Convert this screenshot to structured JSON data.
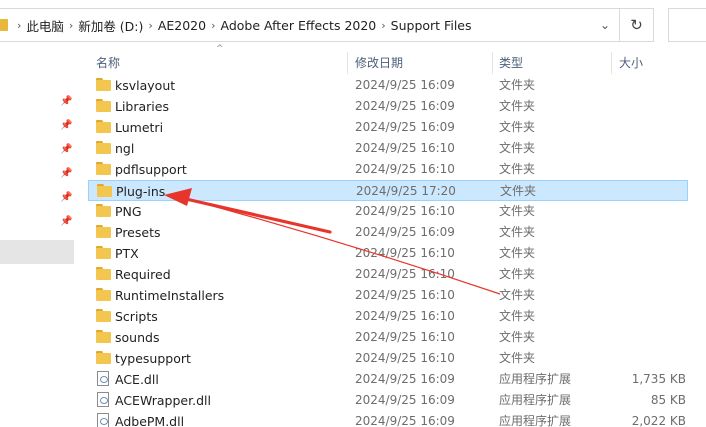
{
  "address_bar": {
    "breadcrumbs": [
      "此电脑",
      "新加卷 (D:)",
      "AE2020",
      "Adobe After Effects 2020",
      "Support Files"
    ]
  },
  "columns": {
    "name": "名称",
    "date": "修改日期",
    "type": "类型",
    "size": "大小"
  },
  "files": [
    {
      "name": "ksvlayout",
      "date": "2024/9/25 16:09",
      "type": "文件夹",
      "size": "",
      "kind": "folder"
    },
    {
      "name": "Libraries",
      "date": "2024/9/25 16:09",
      "type": "文件夹",
      "size": "",
      "kind": "folder"
    },
    {
      "name": "Lumetri",
      "date": "2024/9/25 16:09",
      "type": "文件夹",
      "size": "",
      "kind": "folder"
    },
    {
      "name": "ngl",
      "date": "2024/9/25 16:10",
      "type": "文件夹",
      "size": "",
      "kind": "folder"
    },
    {
      "name": "pdflsupport",
      "date": "2024/9/25 16:10",
      "type": "文件夹",
      "size": "",
      "kind": "folder"
    },
    {
      "name": "Plug-ins",
      "date": "2024/9/25 17:20",
      "type": "文件夹",
      "size": "",
      "kind": "folder",
      "selected": true
    },
    {
      "name": "PNG",
      "date": "2024/9/25 16:10",
      "type": "文件夹",
      "size": "",
      "kind": "folder"
    },
    {
      "name": "Presets",
      "date": "2024/9/25 16:09",
      "type": "文件夹",
      "size": "",
      "kind": "folder"
    },
    {
      "name": "PTX",
      "date": "2024/9/25 16:10",
      "type": "文件夹",
      "size": "",
      "kind": "folder"
    },
    {
      "name": "Required",
      "date": "2024/9/25 16:10",
      "type": "文件夹",
      "size": "",
      "kind": "folder"
    },
    {
      "name": "RuntimeInstallers",
      "date": "2024/9/25 16:10",
      "type": "文件夹",
      "size": "",
      "kind": "folder"
    },
    {
      "name": "Scripts",
      "date": "2024/9/25 16:10",
      "type": "文件夹",
      "size": "",
      "kind": "folder"
    },
    {
      "name": "sounds",
      "date": "2024/9/25 16:10",
      "type": "文件夹",
      "size": "",
      "kind": "folder"
    },
    {
      "name": "typesupport",
      "date": "2024/9/25 16:10",
      "type": "文件夹",
      "size": "",
      "kind": "folder"
    },
    {
      "name": "ACE.dll",
      "date": "2024/9/25 16:09",
      "type": "应用程序扩展",
      "size": "1,735 KB",
      "kind": "dll"
    },
    {
      "name": "ACEWrapper.dll",
      "date": "2024/9/25 16:09",
      "type": "应用程序扩展",
      "size": "85 KB",
      "kind": "dll"
    },
    {
      "name": "AdbePM.dll",
      "date": "2024/9/25 16:09",
      "type": "应用程序扩展",
      "size": "2,022 KB",
      "kind": "dll"
    }
  ],
  "icons": {
    "folder": "folder-icon",
    "dll": "dll-file-icon",
    "pin": "pin-icon",
    "refresh": "refresh-icon",
    "dropdown": "chevron-down-icon",
    "separator": "chevron-right-icon"
  },
  "colors": {
    "selection_fill": "#cce8ff",
    "selection_border": "#99d1ff",
    "annotation_arrow": "#e8352b",
    "folder_yellow": "#f3c74f"
  }
}
